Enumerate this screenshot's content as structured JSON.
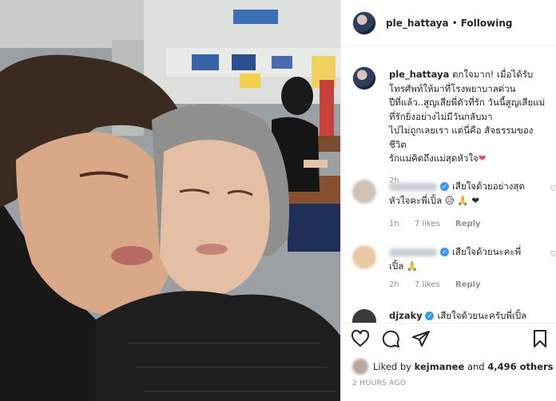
{
  "post": {
    "username": "ple_hattaya",
    "follow_status": "Following",
    "caption_username": "ple_hattaya",
    "caption_lines": [
      "ตกใจมาก! เมื่อได้รับ",
      "โทรศัพท์ให้มาที่โรงพยาบาลด่วน",
      "ปีที่แล้ว..สูญเสียพี่ตัวที่รัก วันนี้สูญเสียแม่",
      "ที่รักยิ่งอย่างไม่มีวันกลับมา",
      "ไปไม่ถูกเลยเรา แต่นี่คือ สัจธรรมของชีวิต",
      "รักแม่คิดถึงแม่สุดหัวใจ"
    ],
    "caption_heart": "❤",
    "caption_time": "2h"
  },
  "comments": [
    {
      "text_line1": "เสียใจด้วยอย่างสุด",
      "text_line2": "หัวใจคะพี่เปิ้ล 😥 🙏 ❤",
      "time": "1h",
      "likes": "7 likes",
      "reply": "Reply"
    },
    {
      "text_line1": "เสียใจด้วยนะคะพี่",
      "text_line2": "เปิ้ล 🙏",
      "time": "2h",
      "likes": "7 likes",
      "reply": "Reply"
    },
    {
      "username_partial": "djzaky",
      "text_line1": "เสียใจด้วยนะครับพี่เปิ้ล"
    }
  ],
  "likes": {
    "prefix": "Liked by",
    "user": "kejmanee",
    "middle": "and",
    "others": "4,496 others"
  },
  "posted_ago": "2 HOURS AGO",
  "icons": {
    "like": "heart-outline-icon",
    "comment": "comment-icon",
    "share": "paper-plane-icon",
    "save": "bookmark-icon",
    "verified": "verified-badge-icon"
  },
  "colors": {
    "text": "#262626",
    "muted": "#8e8e8e",
    "verified": "#3897f0",
    "heart": "#ed4956"
  }
}
